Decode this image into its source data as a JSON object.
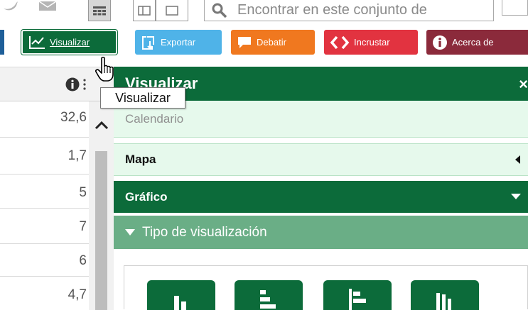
{
  "search": {
    "placeholder": "Encontrar en este conjunto de"
  },
  "toolbar": {
    "visualizar_label": "Visualizar",
    "exportar_label": "Exportar",
    "debatir_label": "Debatir",
    "incrustar_label": "Incrustar",
    "acerca_label": "Acerca de"
  },
  "grid": {
    "values": [
      "32,6",
      "1,7",
      "5",
      "7",
      "6",
      "4,7"
    ]
  },
  "panel": {
    "title": "Visualizar",
    "close_glyph": "×",
    "sections": {
      "calendario": "Calendario",
      "mapa": "Mapa",
      "grafico": "Gráfico",
      "tipo": "Tipo de visualización"
    }
  },
  "tooltip": {
    "text": "Visualizar"
  },
  "colors": {
    "green_dark": "#0c6b3a",
    "green_light": "#e6f9ec",
    "green_mid": "#6aae86",
    "exportar": "#4fb3e8",
    "debatir": "#f0781f",
    "incrustar": "#e23340",
    "acerca": "#8b2a3b"
  }
}
